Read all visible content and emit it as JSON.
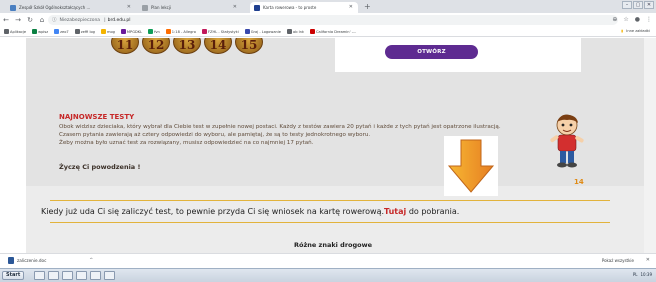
{
  "browser": {
    "tabs": [
      {
        "title": "Zespół Szkół Ogólnokształcących ...",
        "favicon_color": "#4a7fc1",
        "active": false
      },
      {
        "title": "Plan lekcji",
        "favicon_color": "#9aa0a6",
        "active": false
      },
      {
        "title": "Karta rowerowa - to proste",
        "favicon_color": "#1f3f8f",
        "active": true
      }
    ],
    "new_tab": "+",
    "address": {
      "security_label": "Niezabezpieczona",
      "separator": "|",
      "host": "brd.edu.pl"
    },
    "bookmarks": [
      {
        "label": "Aplikacje",
        "color": "#5f6368"
      },
      {
        "label": "wpisz",
        "color": "#0b8043"
      },
      {
        "label": "zeo7",
        "color": "#4285f4"
      },
      {
        "label": "zeffi log",
        "color": "#5f6368"
      },
      {
        "label": "mog",
        "color": "#f4b400"
      },
      {
        "label": "MPGDKL",
        "color": "#6a1b9a"
      },
      {
        "label": "fvn",
        "color": "#0f9d58"
      },
      {
        "label": "1:18 - Allegro",
        "color": "#ff6d00"
      },
      {
        "label": "FZHL - Statystyki",
        "color": "#c2185b"
      },
      {
        "label": "Graj - Logowanie",
        "color": "#3949ab"
      },
      {
        "label": "ob lnk",
        "color": "#5f6368"
      },
      {
        "label": "California Dreamin' -...",
        "color": "#cc0000"
      }
    ],
    "bookmarks_right": "Inne zakładki"
  },
  "page": {
    "numbers": [
      "11",
      "12",
      "13",
      "14",
      "15"
    ],
    "open_button": "OTWÓRZ",
    "section_title": "NAJNOWSZE TESTY",
    "section_body": "Obok widzisz dzieciaka, który wybrał dla Ciebie test w zupełnie nowej postaci. Każdy z testów zawiera 20 pytań i każde z tych pytań jest opatrzone ilustracją. Czasem pytania zawierają aż cztery odpowiedzi do wyboru, ale pamiętaj, że są to testy jednokrotnego wyboru.",
    "section_rule": "Żeby można było uznać test za rozwiązany, musisz odpowiedzieć na co najmniej 17 pytań.",
    "wish": "Życzę Ci powodzenia !",
    "boy_number": "14",
    "bottom_text": "Kiedy już uda Ci się zaliczyć test, to pewnie przyda Ci się wniosek na kartę rowerową.",
    "bottom_link": "Tutaj",
    "bottom_suffix": " do pobrania.",
    "signs_heading": "Różne znaki drogowe"
  },
  "downloads": {
    "file_name": "zaliczenie.doc",
    "show_all": "Pokaż wszystkie"
  },
  "taskbar": {
    "start": "Start",
    "tray_lang": "PL",
    "tray_time": "10:39"
  },
  "colors": {
    "accent_purple": "#5e2b91",
    "heading_red": "#c62828",
    "arrow_orange": "#f39c12",
    "rule_gold": "#e2b33c"
  }
}
